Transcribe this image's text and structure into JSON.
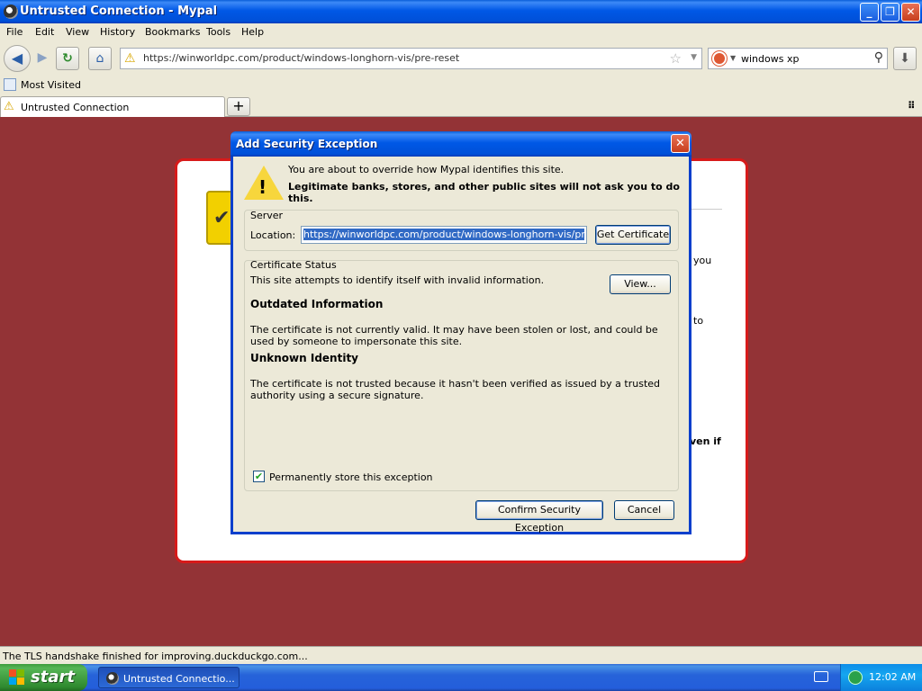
{
  "window": {
    "title": "Untrusted Connection - Mypal"
  },
  "menu": [
    "File",
    "Edit",
    "View",
    "History",
    "Bookmarks",
    "Tools",
    "Help"
  ],
  "nav": {
    "url": "https://winworldpc.com/product/windows-longhorn-vis/pre-reset",
    "search_query": "windows xp"
  },
  "bookmarks": {
    "most_visited": "Most Visited"
  },
  "tab": {
    "label": "Untrusted Connection",
    "new_tab": "+"
  },
  "background_page": {
    "fragment1": "you",
    "fragment2": "to",
    "fragment3": "ven if"
  },
  "dialog": {
    "title": "Add Security Exception",
    "intro_line1": "You are about to override how Mypal identifies this site.",
    "intro_line2": "Legitimate banks, stores, and other public sites will not ask you to do this.",
    "server_label": "Server",
    "location_label": "Location:",
    "location_value": "https://winworldpc.com/product/windows-longhorn-vis/pre-reset",
    "get_certificate": "Get Certificate",
    "cert_status_label": "Certificate Status",
    "cert_status_text": "This site attempts to identify itself with invalid information.",
    "view_button": "View...",
    "outdated_title": "Outdated Information",
    "outdated_text": "The certificate is not currently valid. It may have been stolen or lost, and could be used by someone to impersonate this site.",
    "unknown_title": "Unknown Identity",
    "unknown_text": "The certificate is not trusted because it hasn't been verified as issued by a trusted authority using a secure signature.",
    "permanent_label": "Permanently store this exception",
    "permanent_checked": true,
    "confirm_button": "Confirm Security Exception",
    "cancel_button": "Cancel"
  },
  "status": {
    "text": "The TLS handshake finished for improving.duckduckgo.com..."
  },
  "taskbar": {
    "start": "start",
    "task_label": "Untrusted Connectio...",
    "clock": "12:02 AM"
  }
}
